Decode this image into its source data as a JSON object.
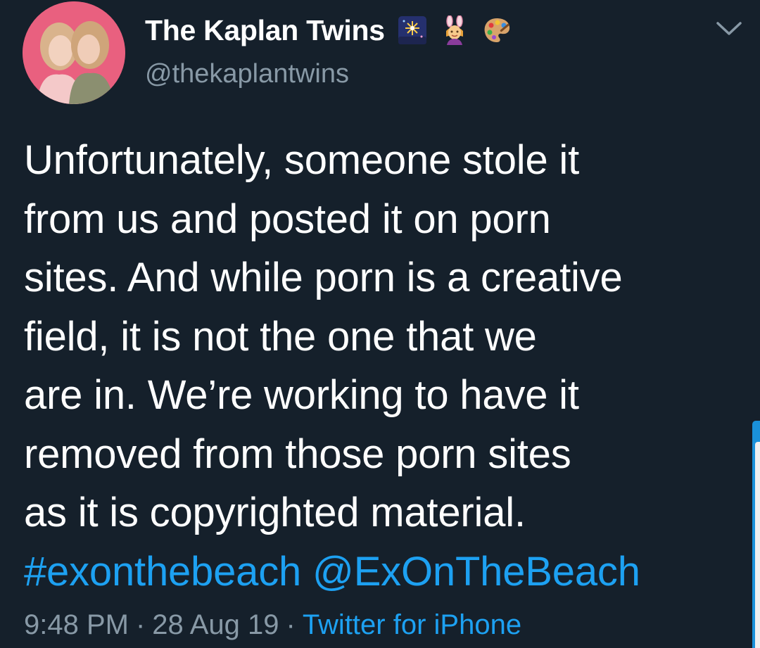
{
  "tweet": {
    "author": {
      "display_name": "The Kaplan Twins",
      "handle": "@thekaplantwins",
      "badges": [
        "fireworks-emoji",
        "bunny-girls-emoji",
        "artist-palette-emoji"
      ]
    },
    "text_lines": [
      "Unfortunately, someone stole it",
      "from us and posted it on porn",
      "sites. And while porn is a creative",
      "field, it is not the one that we",
      "are in. We’re working to have it",
      "removed from those porn sites",
      "as it is copyrighted material."
    ],
    "hashtag": "#exonthebeach",
    "mention": "@ExOnTheBeach",
    "time": "9:48 PM",
    "date": "28 Aug 19",
    "separator": "·",
    "source": "Twitter for iPhone"
  },
  "colors": {
    "background": "#15202b",
    "text": "#ffffff",
    "secondary_text": "#8899a6",
    "link": "#1da1f2"
  }
}
